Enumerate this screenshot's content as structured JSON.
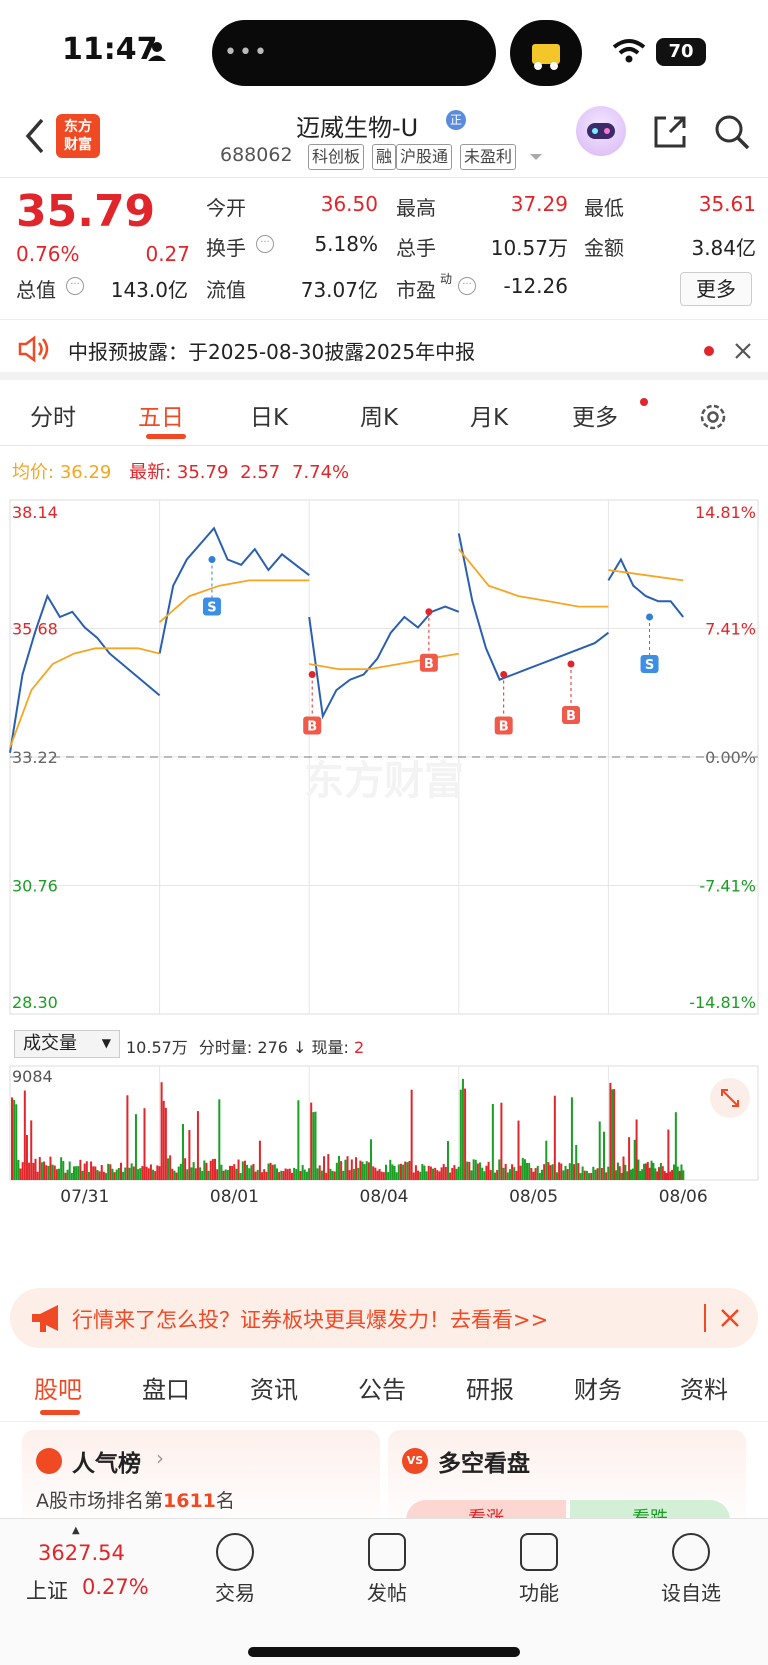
{
  "status_bar": {
    "time": "11:47",
    "battery": "70"
  },
  "header": {
    "logo_text": "东方\n财富",
    "name": "迈威生物-U",
    "code": "688062",
    "tags": [
      "科创板",
      "融",
      "沪股通",
      "未盈利"
    ]
  },
  "quote": {
    "price": "35.79",
    "change_pct": "0.76%",
    "change": "0.27",
    "rows": [
      [
        {
          "label": "今开",
          "value": "36.50",
          "color": "red"
        },
        {
          "label": "最高",
          "value": "37.29",
          "color": "red"
        },
        {
          "label": "最低",
          "value": "35.61",
          "color": "red"
        }
      ],
      [
        {
          "label": "换手",
          "value": "5.18%",
          "color": "black"
        },
        {
          "label": "总手",
          "value": "10.57万",
          "color": "black"
        },
        {
          "label": "金额",
          "value": "3.84亿",
          "color": "black"
        }
      ],
      [
        {
          "label": "流值",
          "value": "73.07亿",
          "color": "black"
        },
        {
          "label": "市盈",
          "value": "-12.26",
          "color": "black"
        }
      ]
    ],
    "total_value_label": "总值",
    "total_value": "143.0亿",
    "pe_sup": "动",
    "more": "更多"
  },
  "notice": {
    "text": "中报预披露：于2025-08-30披露2025年中报"
  },
  "tabs": [
    "分时",
    "五日",
    "日K",
    "周K",
    "月K",
    "更多"
  ],
  "active_tab": "五日",
  "chart_info": {
    "avg_label": "均价:",
    "avg_value": "36.29",
    "latest_label": "最新:",
    "latest_value": "35.79",
    "latest_change": "2.57",
    "latest_pct": "7.74%"
  },
  "chart_data": {
    "type": "line",
    "y_left_ticks": [
      "38.14",
      "35.68",
      "33.22",
      "30.76",
      "28.30"
    ],
    "y_right_ticks": [
      "14.81%",
      "7.41%",
      "0.00%",
      "-7.41%",
      "-14.81%"
    ],
    "ylim": [
      28.3,
      38.14
    ],
    "baseline": 33.22,
    "x_labels": [
      "07/31",
      "08/01",
      "08/04",
      "08/05",
      "08/06"
    ],
    "series": [
      {
        "name": "",
        "color": "#2a5fb0",
        "values": [
          [
            33.3,
            34.8,
            35.6,
            36.3,
            35.9,
            36.0,
            35.7,
            35.5,
            35.2,
            35.0,
            34.8,
            34.6,
            34.4
          ],
          [
            35.2,
            36.5,
            37.0,
            37.3,
            37.6,
            37.0,
            36.9,
            37.2,
            36.8,
            37.1,
            36.9,
            36.7
          ],
          [
            35.9,
            34.0,
            34.5,
            34.7,
            34.8,
            35.1,
            35.6,
            35.9,
            35.7,
            36.0,
            36.1,
            36.0
          ],
          [
            37.5,
            36.2,
            35.3,
            34.7,
            34.8,
            34.9,
            35.0,
            35.1,
            35.2,
            35.3,
            35.4,
            35.6
          ],
          [
            36.6,
            37.0,
            36.5,
            36.3,
            36.2,
            36.2,
            35.9
          ]
        ]
      },
      {
        "name": "",
        "color": "#f5a623",
        "values": [
          [
            33.4,
            34.5,
            35.0,
            35.2,
            35.3,
            35.3,
            35.3,
            35.2
          ],
          [
            35.8,
            36.3,
            36.5,
            36.6,
            36.6,
            36.6
          ],
          [
            35.0,
            34.9,
            34.9,
            35.0,
            35.1,
            35.2
          ],
          [
            37.2,
            36.5,
            36.3,
            36.2,
            36.1,
            36.1
          ],
          [
            36.8,
            36.7,
            36.6
          ]
        ]
      }
    ],
    "markers": [
      {
        "label": "S",
        "type": "sell"
      },
      {
        "label": "B",
        "type": "buy"
      },
      {
        "label": "B",
        "type": "buy"
      },
      {
        "label": "B",
        "type": "buy"
      },
      {
        "label": "B",
        "type": "buy"
      },
      {
        "label": "S",
        "type": "sell"
      }
    ],
    "volume": {
      "label": "成交量",
      "total": "10.57万",
      "fenshi_label": "分时量: 276",
      "now_label": "现量:",
      "now_value": "2",
      "max": "9084",
      "peaks": [
        8200,
        8900,
        4200,
        8400,
        9084,
        3800,
        4500,
        3200,
        6600,
        3000,
        2000
      ]
    }
  },
  "ad_banner": {
    "text": "行情来了怎么投？证券板块更具爆发力！去看看>>"
  },
  "sub_tabs": [
    "股吧",
    "盘口",
    "资讯",
    "公告",
    "研报",
    "财务",
    "资料"
  ],
  "cards": {
    "left_title": "人气榜",
    "left_sub_prefix": "A股市场排名第",
    "left_rank": "1611",
    "left_sub_suffix": "名",
    "right_title": "多空看盘",
    "right_bull": "看涨",
    "right_bear": "看跌"
  },
  "bottom_nav": {
    "index_value": "3627.54",
    "index_name": "上证",
    "index_pct": "0.27%",
    "items": [
      "交易",
      "发帖",
      "功能",
      "设自选"
    ]
  },
  "colors": {
    "up": "#e0262a",
    "down": "#1a9e24",
    "accent": "#f04a24",
    "price_line": "#2a5fb0",
    "avg_line": "#f5a623"
  }
}
